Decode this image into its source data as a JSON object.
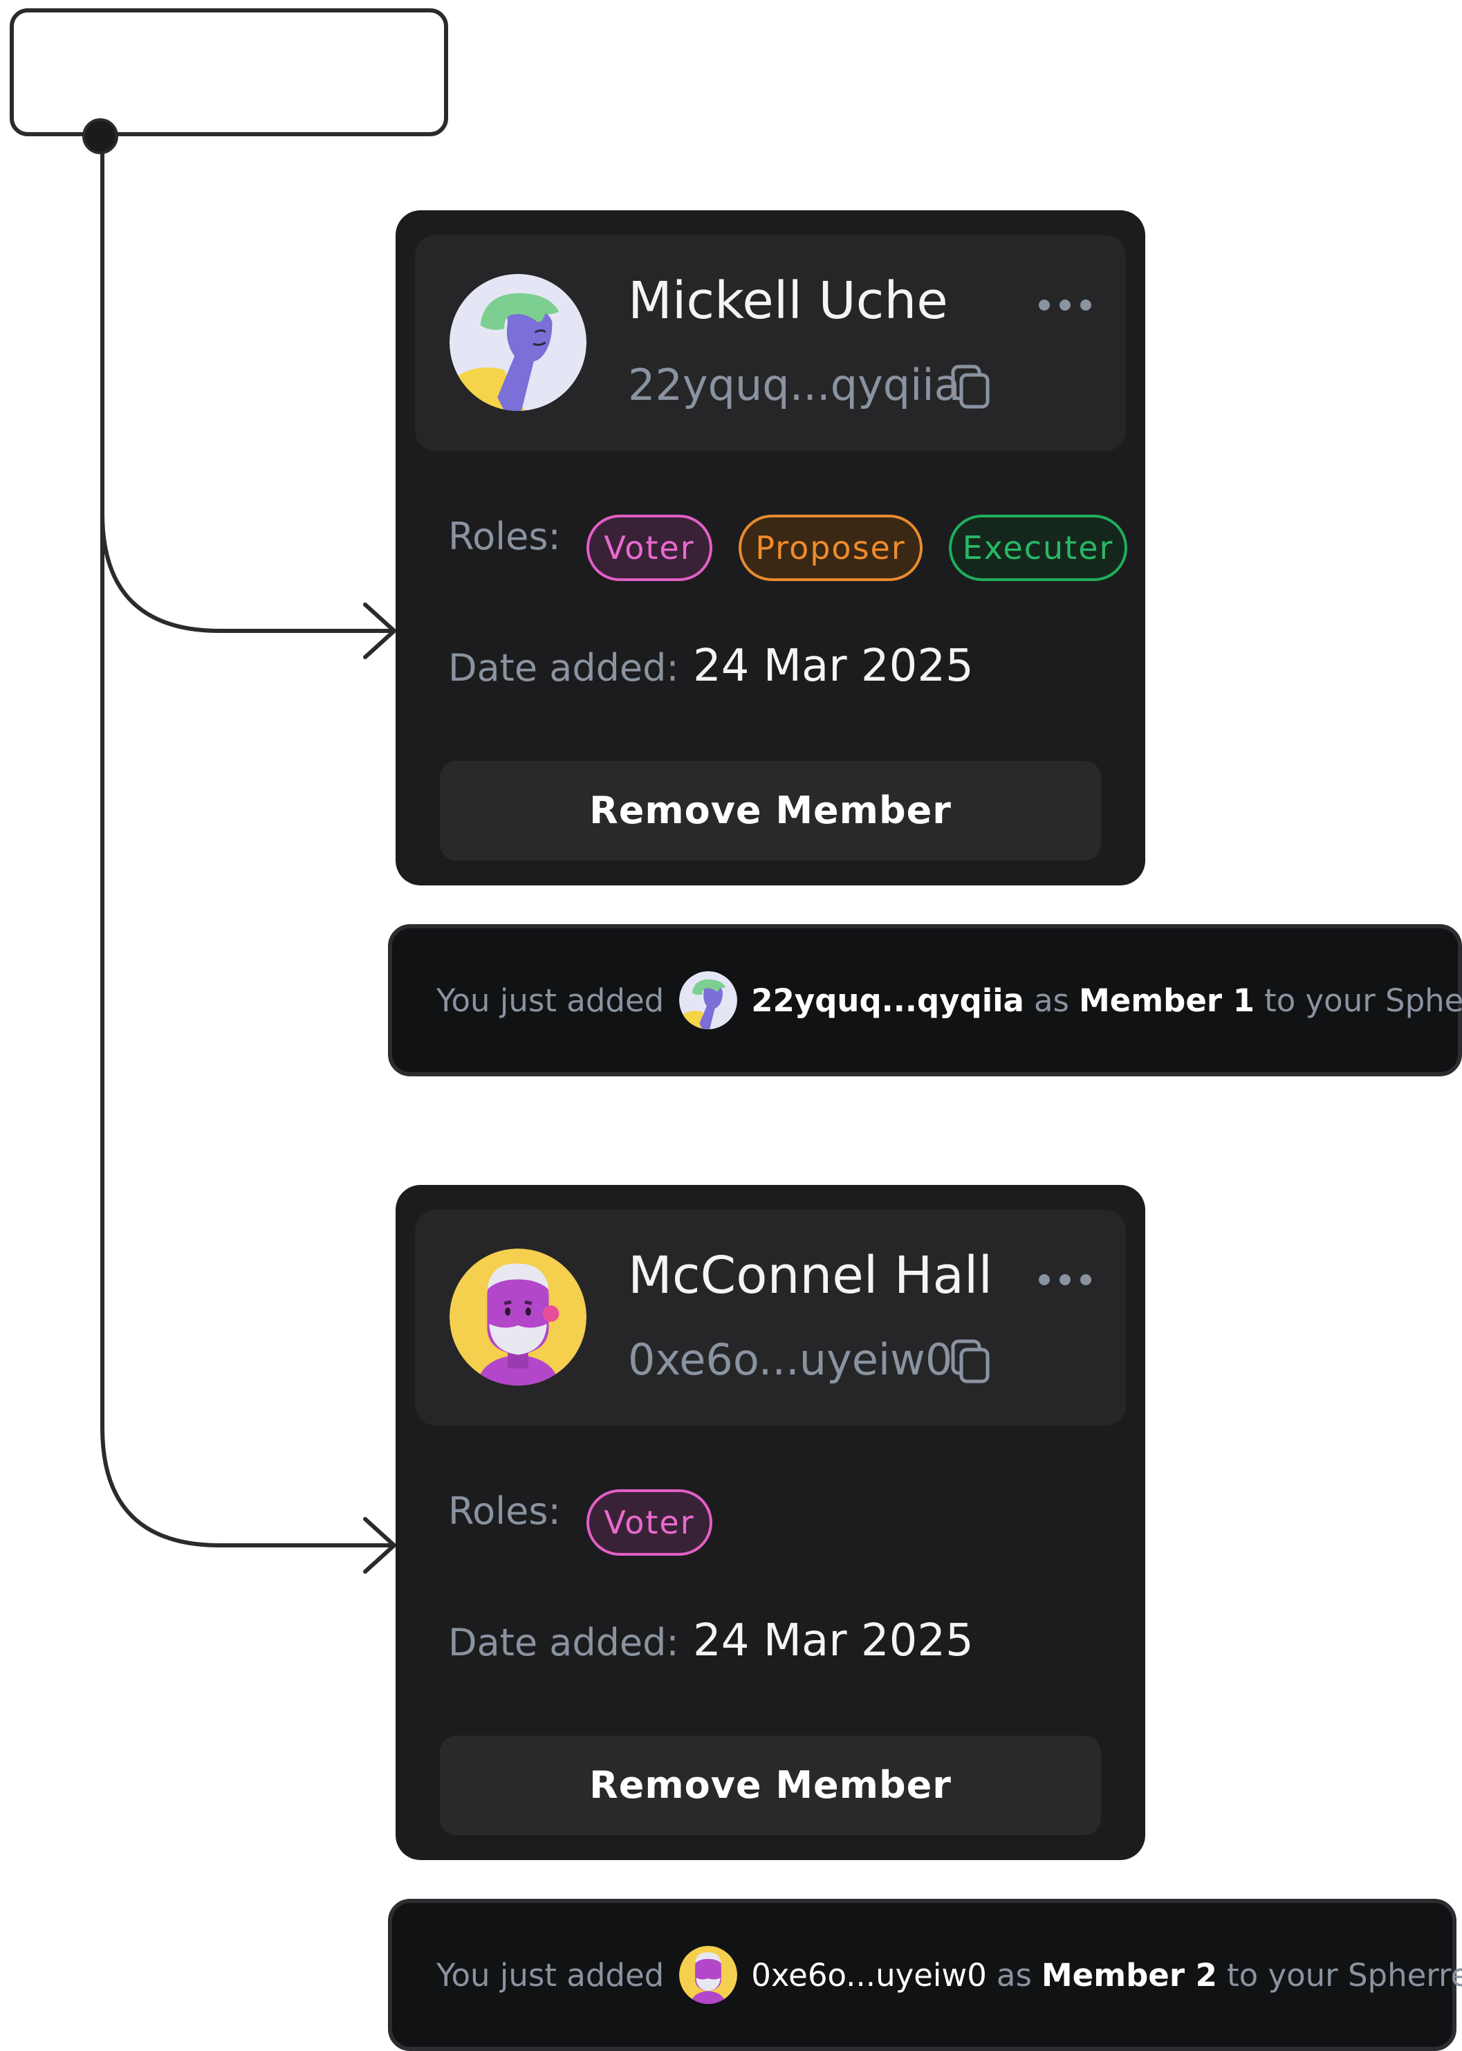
{
  "members": [
    {
      "name": "Mickell Uche",
      "address": "22yquq...qyqiia",
      "roles_label": "Roles:",
      "roles": [
        "Voter",
        "Proposer",
        "Executer"
      ],
      "date_label": "Date added:",
      "date_value": "24 Mar 2025",
      "remove_label": "Remove Member",
      "avatar": "green-hair-character-avatar"
    },
    {
      "name": "McConnel Hall",
      "address": "0xe6o...uyeiw0",
      "roles_label": "Roles:",
      "roles": [
        "Voter"
      ],
      "date_label": "Date added:",
      "date_value": "24 Mar 2025",
      "remove_label": "Remove Member",
      "avatar": "bearded-character-avatar"
    }
  ],
  "toasts": [
    {
      "prefix": "You just added",
      "address": "22yquq...qyqiia",
      "as": "as",
      "member_label": "Member 1",
      "suffix": "to your Spherre"
    },
    {
      "prefix": "You just added",
      "address": "0xe6o...uyeiw0",
      "as": "as",
      "member_label": "Member 2",
      "suffix": "to your Spherre"
    }
  ],
  "colors": {
    "card_bg": "#1c1c1e",
    "voter": "#e86bd0",
    "proposer": "#ef8c2a",
    "executer": "#28b866",
    "muted_text": "#8a93a0"
  }
}
